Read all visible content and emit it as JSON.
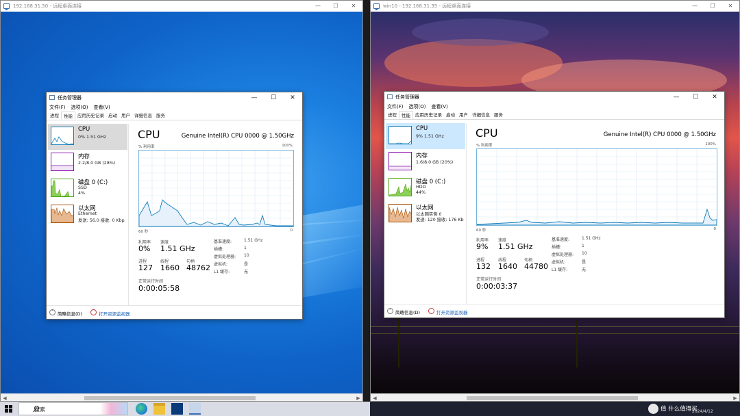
{
  "left_window": {
    "title": "192.168.31.50 - 远程桌面连接",
    "tm": {
      "title": "任务管理器",
      "menu": [
        "文件(F)",
        "选项(O)",
        "查看(V)"
      ],
      "tabs": [
        "进程",
        "性能",
        "应用历史记录",
        "启动",
        "用户",
        "详细信息",
        "服务"
      ],
      "sidebar": {
        "cpu": {
          "name": "CPU",
          "sub1": "0% 1.51 GHz"
        },
        "mem": {
          "name": "内存",
          "sub1": "2.2/8.0 GB (28%)"
        },
        "disk": {
          "name": "磁盘 0 (C:)",
          "sub1": "SSD",
          "sub2": "4%"
        },
        "net": {
          "name": "以太网",
          "sub1": "Ethernet",
          "sub2": "发送: 56.0  接收: 0 Kbp"
        }
      },
      "heading": "CPU",
      "cpu_name": "Genuine Intel(R) CPU 0000 @ 1.50GHz",
      "util_label": "% 利用率",
      "util_max": "100%",
      "time_left": "60 秒",
      "time_right": "0",
      "stats": {
        "util_lbl": "利用率",
        "util": "0%",
        "speed_lbl": "速度",
        "speed": "1.51 GHz",
        "proc_lbl": "进程",
        "proc": "127",
        "thread_lbl": "线程",
        "thread": "1660",
        "handle_lbl": "句柄",
        "handle": "48762",
        "uptime_lbl": "正常运行时间",
        "uptime": "0:00:05:58"
      },
      "kv": {
        "base_lbl": "基准速度:",
        "base": "1.51 GHz",
        "socket_lbl": "插槽:",
        "socket": "1",
        "vproc_lbl": "虚拟处理器:",
        "vproc": "10",
        "vm_lbl": "虚拟机:",
        "vm": "是",
        "l1_lbl": "L1 缓存:",
        "l1": "无"
      },
      "footer": {
        "brief": "简略信息(D)",
        "monitor": "打开资源监视器"
      }
    }
  },
  "right_window": {
    "title": "win10 - 192.168.31.35 - 远程桌面连接",
    "tm": {
      "title": "任务管理器",
      "menu": [
        "文件(F)",
        "选项(O)",
        "查看(V)"
      ],
      "tabs": [
        "进程",
        "性能",
        "应用历史记录",
        "启动",
        "用户",
        "详细信息",
        "服务"
      ],
      "sidebar": {
        "cpu": {
          "name": "CPU",
          "sub1": "9% 1.51 GHz"
        },
        "mem": {
          "name": "内存",
          "sub1": "1.6/8.0 GB (20%)"
        },
        "disk": {
          "name": "磁盘 0 (C:)",
          "sub1": "HDD",
          "sub2": "44%"
        },
        "net": {
          "name": "以太网",
          "sub1": "以太网实例 0",
          "sub2": "发送: 120  接收: 176 Kb"
        }
      },
      "heading": "CPU",
      "cpu_name": "Genuine Intel(R) CPU 0000 @ 1.50GHz",
      "util_label": "% 利用率",
      "util_max": "100%",
      "time_left": "60 秒",
      "time_right": "0",
      "stats": {
        "util_lbl": "利用率",
        "util": "9%",
        "speed_lbl": "速度",
        "speed": "1.51 GHz",
        "proc_lbl": "进程",
        "proc": "132",
        "thread_lbl": "线程",
        "thread": "1640",
        "handle_lbl": "句柄",
        "handle": "44780",
        "uptime_lbl": "正常运行时间",
        "uptime": "0:00:03:37"
      },
      "kv": {
        "base_lbl": "基准速度:",
        "base": "1.51 GHz",
        "socket_lbl": "插槽:",
        "socket": "1",
        "vproc_lbl": "虚拟处理器:",
        "vproc": "10",
        "vm_lbl": "虚拟机:",
        "vm": "是",
        "l1_lbl": "L1 缓存:",
        "l1": "无"
      },
      "footer": {
        "brief": "简略信息(D)",
        "monitor": "打开资源监视器"
      }
    }
  },
  "taskbar": {
    "search_text": "搜索",
    "watermark": "值 什么值得买",
    "date": "2024/4/12"
  },
  "colors": {
    "cpu_line": "#117dbb",
    "mem_line": "#8b12ae",
    "disk_line": "#4da60c",
    "net_line": "#a74f01",
    "win_blue": "#0f63c8"
  },
  "icons": [
    "remote-desktop-icon",
    "task-manager-icon",
    "windows-start-icon",
    "search-icon",
    "chevron-up-icon",
    "resource-monitor-icon"
  ]
}
